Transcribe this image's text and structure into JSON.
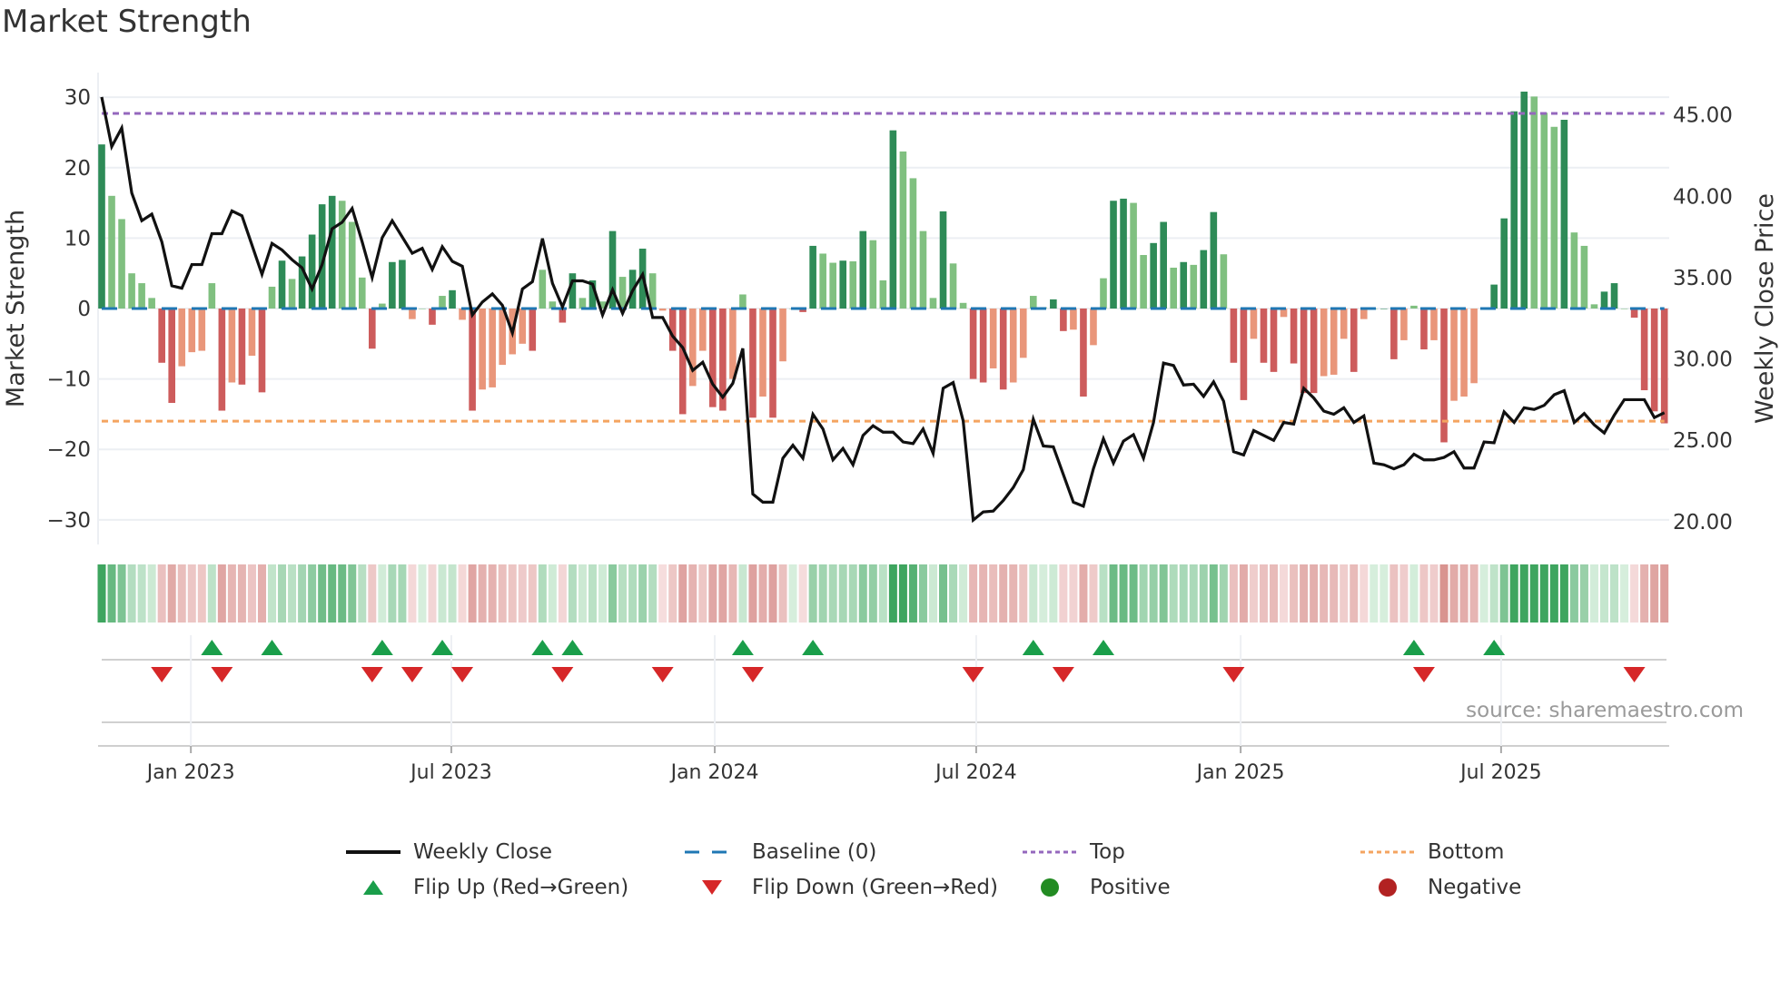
{
  "title": "Market Strength",
  "source": "source: sharemaestro.com",
  "legend": {
    "weekly_close": "Weekly Close",
    "baseline": "Baseline (0)",
    "top": "Top",
    "bottom": "Bottom",
    "flip_up": "Flip Up (Red→Green)",
    "flip_down": "Flip Down (Green→Red)",
    "positive": "Positive",
    "negative": "Negative"
  },
  "colors": {
    "bar_pos_strong": "#2e8b57",
    "bar_pos_weak": "#80c080",
    "bar_neg_strong": "#cd5c5c",
    "bar_neg_weak": "#e9967a",
    "close": "#111111",
    "baseline": "#1f77b4",
    "top": "#9467bd",
    "bottom": "#f4a460",
    "flip_up": "#1a9e4a",
    "flip_down": "#d62728",
    "positive": "#228b22",
    "negative": "#b22222"
  },
  "chart_data": {
    "type": "bar",
    "title": "Market Strength",
    "xlabel": "",
    "ylabel": "Market Strength",
    "y2label": "Weekly Close Price",
    "ylim": [
      -33.5,
      33.5
    ],
    "y2lim": [
      18.6,
      47.6
    ],
    "yticks": [
      "30",
      "20",
      "10",
      "0",
      "−10",
      "−20",
      "−30"
    ],
    "ytick_values": [
      30,
      20,
      10,
      0,
      -10,
      -20,
      -30
    ],
    "y2ticks": [
      "45.00",
      "40.00",
      "35.00",
      "30.00",
      "25.00",
      "20.00"
    ],
    "y2tick_values": [
      45,
      40,
      35,
      30,
      25,
      20
    ],
    "x_unit": "week index",
    "xticks": [
      "Jan 2023",
      "Jul 2023",
      "Jan 2024",
      "Jul 2024",
      "Jan 2025",
      "Jul 2025"
    ],
    "xtick_values": [
      8.9,
      34.9,
      61.2,
      87.3,
      113.7,
      139.7
    ],
    "top_level": 27.7,
    "bottom_level": -16.0,
    "baseline": 0,
    "grid": true,
    "legend_position": "bottom",
    "series": [
      {
        "name": "Market Strength",
        "type": "bar",
        "values": [
          23.3,
          16,
          12.7,
          5,
          3.6,
          1.5,
          -7.7,
          -13.4,
          -8.2,
          -6.2,
          -6,
          3.6,
          -14.5,
          -10.5,
          -10.8,
          -6.7,
          -11.9,
          3.1,
          6.8,
          4.2,
          7.4,
          10.5,
          14.8,
          16,
          15.3,
          12.3,
          4.4,
          -5.7,
          0.7,
          6.6,
          6.9,
          -1.5,
          0,
          -2.3,
          1.8,
          2.6,
          -1.6,
          -14.5,
          -11.5,
          -11.2,
          -8,
          -6.5,
          -5,
          -6,
          5.5,
          1,
          -2,
          5,
          1.5,
          4,
          1,
          11,
          4.5,
          5.5,
          8.5,
          5,
          -0.3,
          -6,
          -15,
          -11,
          -6,
          -14,
          -14.5,
          -10,
          2,
          -15.5,
          -12.5,
          -15.5,
          -7.5,
          0,
          -0.5,
          8.9,
          7.8,
          6.5,
          6.8,
          6.7,
          11,
          9.7,
          4,
          25.3,
          22.3,
          18.5,
          11,
          1.5,
          13.8,
          6.4,
          0.8,
          -10,
          -10.5,
          -8.5,
          -11.5,
          -10.5,
          -7,
          1.8,
          0.2,
          1.3,
          -3.2,
          -3,
          -12.5,
          -5.2,
          4.3,
          15.3,
          15.6,
          15,
          7.6,
          9.3,
          12.3,
          5.8,
          6.6,
          6.2,
          8.3,
          13.7,
          7.7,
          -7.7,
          -13,
          -4.3,
          -7.7,
          -9,
          -1.2,
          -7.8,
          -12,
          -12,
          -9.6,
          -9.4,
          -4.3,
          -9,
          -1.5,
          0,
          0,
          -7.2,
          -4.5,
          0.4,
          -5.8,
          -4.5,
          -19,
          -13.1,
          -12.5,
          -10.6,
          0,
          3.4,
          12.8,
          28,
          30.8,
          30.1,
          27.8,
          25.8,
          26.8,
          10.8,
          8.9,
          0.6,
          2.4,
          3.6,
          0,
          -1.3,
          -11.6,
          -14.6,
          -16.3
        ]
      },
      {
        "name": "Weekly Close",
        "type": "line",
        "axis": "right",
        "values": [
          46.1,
          43.05,
          44.2,
          40.2,
          38.5,
          38.9,
          37.2,
          34.5,
          34.35,
          35.8,
          35.8,
          37.7,
          37.7,
          39.1,
          38.8,
          37.0,
          35.2,
          37.1,
          36.7,
          36.1,
          35.6,
          34.3,
          35.8,
          38.0,
          38.4,
          39.25,
          37.2,
          35.0,
          37.45,
          38.5,
          37.5,
          36.5,
          36.8,
          35.5,
          36.9,
          36.0,
          35.7,
          32.7,
          33.5,
          34.0,
          33.3,
          31.6,
          34.3,
          34.75,
          37.4,
          34.65,
          33.2,
          34.8,
          34.8,
          34.6,
          32.7,
          34.25,
          32.8,
          34.2,
          35.2,
          32.55,
          32.55,
          31.4,
          30.7,
          29.3,
          29.8,
          28.45,
          27.65,
          28.5,
          30.65,
          21.7,
          21.2,
          21.2,
          23.9,
          24.7,
          23.9,
          26.6,
          25.7,
          23.8,
          24.5,
          23.5,
          25.3,
          25.9,
          25.5,
          25.5,
          24.9,
          24.8,
          25.7,
          24.2,
          28.2,
          28.55,
          26.2,
          20.1,
          20.6,
          20.65,
          21.3,
          22.1,
          23.2,
          26.3,
          24.65,
          24.6,
          22.9,
          21.2,
          20.95,
          23.25,
          25.1,
          23.6,
          24.95,
          25.35,
          23.9,
          26.1,
          29.75,
          29.6,
          28.4,
          28.45,
          27.7,
          28.6,
          27.4,
          24.3,
          24.1,
          25.6,
          25.3,
          25.0,
          26.1,
          26.0,
          28.2,
          27.6,
          26.8,
          26.6,
          27.0,
          26.1,
          26.5,
          23.6,
          23.5,
          23.25,
          23.5,
          24.15,
          23.8,
          23.8,
          23.95,
          24.3,
          23.3,
          23.3,
          24.9,
          24.85,
          26.75,
          26.1,
          27.0,
          26.9,
          27.15,
          27.8,
          28.05,
          26.1,
          26.65,
          25.95,
          25.45,
          26.55,
          27.5,
          27.5,
          27.5,
          26.4,
          26.7
        ]
      }
    ],
    "flip_up_weeks": [
      11,
      17,
      28,
      34,
      44,
      47,
      64,
      71,
      93,
      100,
      131,
      139
    ],
    "flip_down_weeks": [
      6,
      12,
      27,
      31,
      36,
      46,
      56,
      65,
      87,
      96,
      113,
      132,
      153
    ]
  }
}
